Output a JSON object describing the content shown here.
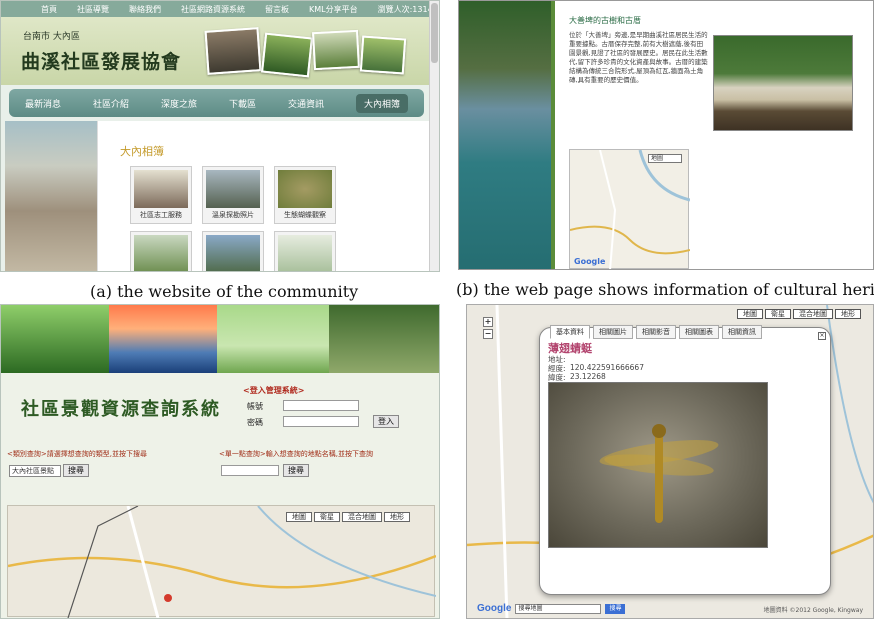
{
  "panel_a": {
    "topbar": [
      "首頁",
      "社區導覽",
      "聯絡我們",
      "社區網路資源系統",
      "留言板",
      "KML分享平台",
      "瀏覽人次:13144"
    ],
    "city": "台南市 大內區",
    "logo": "曲溪社區發展協會",
    "nav": [
      "最新消息",
      "社區介紹",
      "深度之旅",
      "下載區",
      "交通資訊",
      "大內相簿"
    ],
    "nav_active": 5,
    "section_title": "大內相簿",
    "thumbs": [
      "社區志工服務",
      "溫泉探勘照片",
      "生態蝴蝶觀察",
      "",
      "",
      ""
    ]
  },
  "panel_b": {
    "title": "大善埤的古樹和古厝",
    "text": "位於「大善埤」旁邊,是早期曲溪社區居民生活的重要據點。古厝保存完整,前有大樹遮蔭,後有田園景觀,見證了社區的發展歷史。居民在此生活數代,留下許多珍貴的文化資產與故事。古厝的建築結構為傳統三合院形式,屋頂為紅瓦,牆面為土角磚,具有重要的歷史價值。",
    "map_select": "地圖",
    "google": "Google"
  },
  "panel_c": {
    "title": "社區景觀資源查詢系統",
    "login_title": "<登入管理系統>",
    "account_label": "帳號",
    "password_label": "密碼",
    "login_button": "登入",
    "hint_left": "<類別查詢>請選擇想查詢的類型,並按下搜尋",
    "hint_right": "<單一點查詢>輸入想查詢的地點名稱,並按下查詢",
    "category_select": "大內社區景點",
    "search_button": "搜尋",
    "search_button_2": "搜尋",
    "map_tabs": [
      "地圖",
      "衛星",
      "混合地圖",
      "地形"
    ]
  },
  "panel_d": {
    "map_tabs": [
      "地圖",
      "衛星",
      "混合地圖",
      "地形"
    ],
    "popup_tabs": [
      "基本資料",
      "相關圖片",
      "相關影音",
      "相關圖表",
      "相關資訊"
    ],
    "species": "薄翅蜻蜓",
    "address_label": "地址:",
    "lng_label": "經度:",
    "lng_value": "120.422591666667",
    "lat_label": "緯度:",
    "lat_value": "23.12268",
    "google": "Google",
    "search_placeholder": "搜尋地圖",
    "search_button": "搜尋",
    "copyright": "地圖資料 ©2012 Google, Kingway"
  },
  "captions": {
    "a": "(a) the website of the community",
    "b": "(b) the web page shows information of cultural heritage"
  },
  "colors": {
    "nav_green": "#5d8b85",
    "brand_dark_green": "#2d5a23",
    "login_red": "#b02a1e",
    "species_pink": "#b3456f"
  }
}
